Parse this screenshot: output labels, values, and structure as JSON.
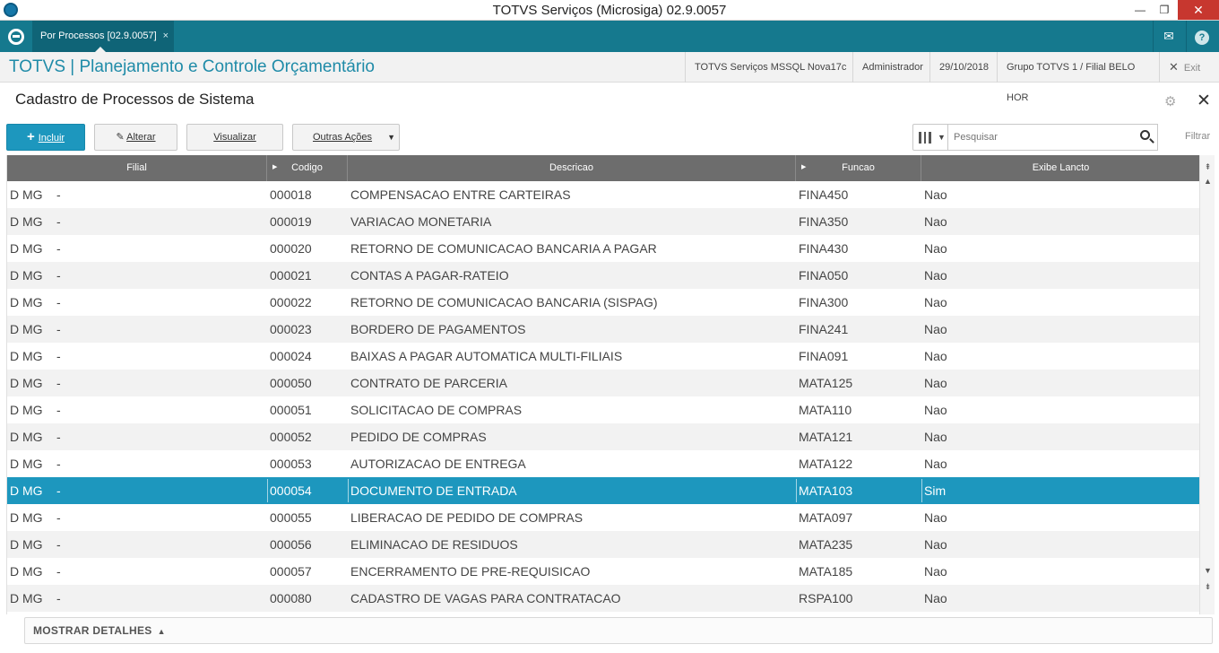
{
  "window": {
    "title": "TOTVS Serviços (Microsiga) 02.9.0057",
    "minimize_glyph": "—",
    "maximize_glyph": "❐",
    "close_glyph": "✕"
  },
  "tabbar": {
    "tab_label": "Por Processos [02.9.0057]",
    "tab_close": "×",
    "mail_glyph": "✉",
    "help_glyph": "?"
  },
  "header": {
    "module_title": "TOTVS | Planejamento e Controle Orçamentário",
    "environment": "TOTVS Serviços MSSQL Nova17c",
    "user": "Administrador",
    "date": "29/10/2018",
    "branch": "Grupo TOTVS 1 / Filial BELO HOR",
    "exit_label": "Exit",
    "exit_glyph": "✕"
  },
  "page": {
    "title": "Cadastro de Processos de Sistema",
    "gear_glyph": "⚙",
    "close_glyph": "✕"
  },
  "toolbar": {
    "incluir_label": "Incluir",
    "incluir_glyph": "+",
    "alterar_label": "Alterar",
    "alterar_glyph": "✎",
    "visualizar_label": "Visualizar",
    "outras_label": "Outras Ações",
    "outras_caret": "▼",
    "colpicker_caret": "▼",
    "search_placeholder": "Pesquisar",
    "filter_label": "Filtrar"
  },
  "grid": {
    "columns": {
      "filial": "Filial",
      "codigo": "Codigo",
      "descricao": "Descricao",
      "funcao": "Funcao",
      "exibe": "Exibe Lancto",
      "sort_glyph": "▶"
    },
    "rows": [
      {
        "filial": "D MG",
        "dash": "-",
        "codigo": "000018",
        "descricao": "COMPENSACAO ENTRE CARTEIRAS",
        "funcao": "FINA450",
        "exibe": "Nao"
      },
      {
        "filial": "D MG",
        "dash": "-",
        "codigo": "000019",
        "descricao": "VARIACAO MONETARIA",
        "funcao": "FINA350",
        "exibe": "Nao"
      },
      {
        "filial": "D MG",
        "dash": "-",
        "codigo": "000020",
        "descricao": "RETORNO DE COMUNICACAO BANCARIA A PAGAR",
        "funcao": "FINA430",
        "exibe": "Nao"
      },
      {
        "filial": "D MG",
        "dash": "-",
        "codigo": "000021",
        "descricao": "CONTAS A PAGAR-RATEIO",
        "funcao": "FINA050",
        "exibe": "Nao"
      },
      {
        "filial": "D MG",
        "dash": "-",
        "codigo": "000022",
        "descricao": "RETORNO DE COMUNICACAO BANCARIA (SISPAG)",
        "funcao": "FINA300",
        "exibe": "Nao"
      },
      {
        "filial": "D MG",
        "dash": "-",
        "codigo": "000023",
        "descricao": "BORDERO DE PAGAMENTOS",
        "funcao": "FINA241",
        "exibe": "Nao"
      },
      {
        "filial": "D MG",
        "dash": "-",
        "codigo": "000024",
        "descricao": "BAIXAS A PAGAR AUTOMATICA MULTI-FILIAIS",
        "funcao": "FINA091",
        "exibe": "Nao"
      },
      {
        "filial": "D MG",
        "dash": "-",
        "codigo": "000050",
        "descricao": "CONTRATO DE PARCERIA",
        "funcao": "MATA125",
        "exibe": "Nao"
      },
      {
        "filial": "D MG",
        "dash": "-",
        "codigo": "000051",
        "descricao": "SOLICITACAO DE COMPRAS",
        "funcao": "MATA110",
        "exibe": "Nao"
      },
      {
        "filial": "D MG",
        "dash": "-",
        "codigo": "000052",
        "descricao": "PEDIDO DE COMPRAS",
        "funcao": "MATA121",
        "exibe": "Nao"
      },
      {
        "filial": "D MG",
        "dash": "-",
        "codigo": "000053",
        "descricao": "AUTORIZACAO DE ENTREGA",
        "funcao": "MATA122",
        "exibe": "Nao"
      },
      {
        "filial": "D MG",
        "dash": "-",
        "codigo": "000054",
        "descricao": "DOCUMENTO DE ENTRADA",
        "funcao": "MATA103",
        "exibe": "Sim",
        "selected": true
      },
      {
        "filial": "D MG",
        "dash": "-",
        "codigo": "000055",
        "descricao": "LIBERACAO DE PEDIDO DE COMPRAS",
        "funcao": "MATA097",
        "exibe": "Nao"
      },
      {
        "filial": "D MG",
        "dash": "-",
        "codigo": "000056",
        "descricao": "ELIMINACAO DE RESIDUOS",
        "funcao": "MATA235",
        "exibe": "Nao"
      },
      {
        "filial": "D MG",
        "dash": "-",
        "codigo": "000057",
        "descricao": "ENCERRAMENTO DE PRE-REQUISICAO",
        "funcao": "MATA185",
        "exibe": "Nao"
      },
      {
        "filial": "D MG",
        "dash": "-",
        "codigo": "000080",
        "descricao": "CADASTRO DE VAGAS PARA CONTRATACAO",
        "funcao": "RSPA100",
        "exibe": "Nao"
      }
    ]
  },
  "scrollbar": {
    "top_glyph": "⇞",
    "up_glyph": "▲",
    "down_glyph": "▼",
    "bottom_glyph": "⇟"
  },
  "footer": {
    "details_label": "MOSTRAR DETALHES",
    "details_glyph": "▲"
  },
  "colors": {
    "accent": "#1d97be",
    "tabbar": "#15798e",
    "grid_header": "#6d6d6d"
  }
}
